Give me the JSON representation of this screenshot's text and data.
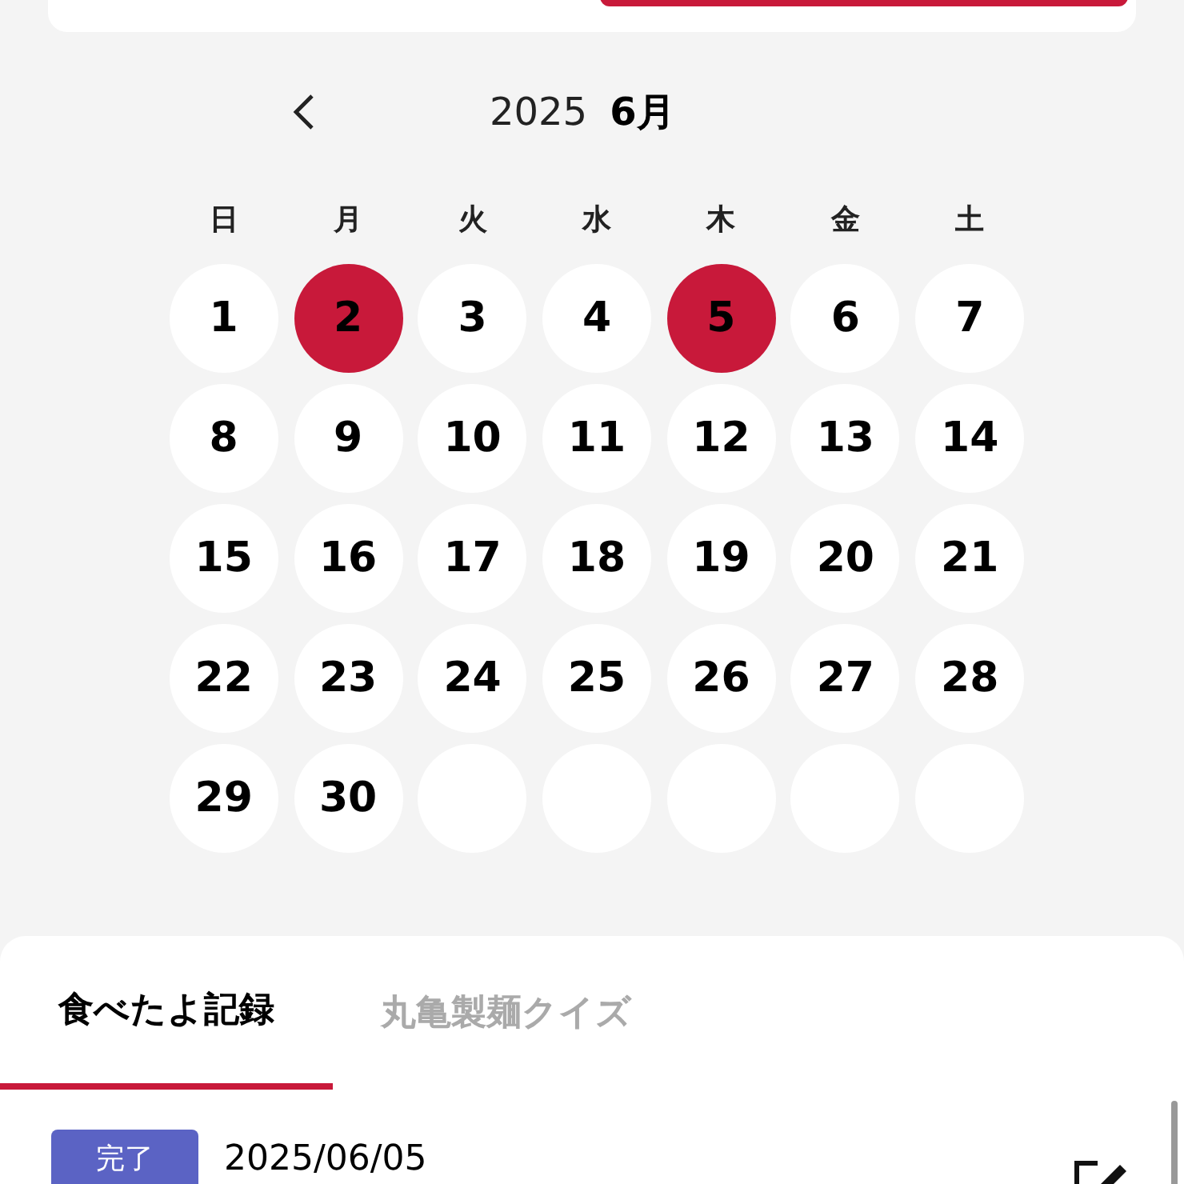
{
  "segments": [
    {
      "selected": false
    },
    {
      "selected": true
    }
  ],
  "calendar": {
    "year": "2025",
    "month": "6月",
    "weekdays": [
      "日",
      "月",
      "火",
      "水",
      "木",
      "金",
      "土"
    ],
    "cells": [
      {
        "kind": "day",
        "day": "1",
        "marked": false
      },
      {
        "kind": "day",
        "day": "2",
        "marked": true
      },
      {
        "kind": "day",
        "day": "3",
        "marked": false
      },
      {
        "kind": "day",
        "day": "4",
        "marked": false
      },
      {
        "kind": "day",
        "day": "5",
        "marked": true
      },
      {
        "kind": "day",
        "day": "6",
        "marked": false
      },
      {
        "kind": "day",
        "day": "7",
        "marked": false
      },
      {
        "kind": "day",
        "day": "8",
        "marked": false
      },
      {
        "kind": "day",
        "day": "9",
        "marked": false
      },
      {
        "kind": "day",
        "day": "10",
        "marked": false
      },
      {
        "kind": "day",
        "day": "11",
        "marked": false
      },
      {
        "kind": "day",
        "day": "12",
        "marked": false
      },
      {
        "kind": "day",
        "day": "13",
        "marked": false
      },
      {
        "kind": "day",
        "day": "14",
        "marked": false
      },
      {
        "kind": "day",
        "day": "15",
        "marked": false
      },
      {
        "kind": "day",
        "day": "16",
        "marked": false
      },
      {
        "kind": "day",
        "day": "17",
        "marked": false
      },
      {
        "kind": "day",
        "day": "18",
        "marked": false
      },
      {
        "kind": "day",
        "day": "19",
        "marked": false
      },
      {
        "kind": "day",
        "day": "20",
        "marked": false
      },
      {
        "kind": "day",
        "day": "21",
        "marked": false
      },
      {
        "kind": "day",
        "day": "22",
        "marked": false
      },
      {
        "kind": "day",
        "day": "23",
        "marked": false
      },
      {
        "kind": "day",
        "day": "24",
        "marked": false
      },
      {
        "kind": "day",
        "day": "25",
        "marked": false
      },
      {
        "kind": "day",
        "day": "26",
        "marked": false
      },
      {
        "kind": "day",
        "day": "27",
        "marked": false
      },
      {
        "kind": "day",
        "day": "28",
        "marked": false
      },
      {
        "kind": "day",
        "day": "29",
        "marked": false
      },
      {
        "kind": "day",
        "day": "30",
        "marked": false
      },
      {
        "kind": "blank"
      },
      {
        "kind": "blank"
      },
      {
        "kind": "blank"
      },
      {
        "kind": "blank"
      },
      {
        "kind": "blank"
      }
    ]
  },
  "tabs": [
    {
      "label": "食べたよ記録",
      "selected": true
    },
    {
      "label": "丸亀製麺クイズ",
      "selected": false
    }
  ],
  "records": [
    {
      "status": "完了",
      "date": "2025/06/05"
    }
  ]
}
